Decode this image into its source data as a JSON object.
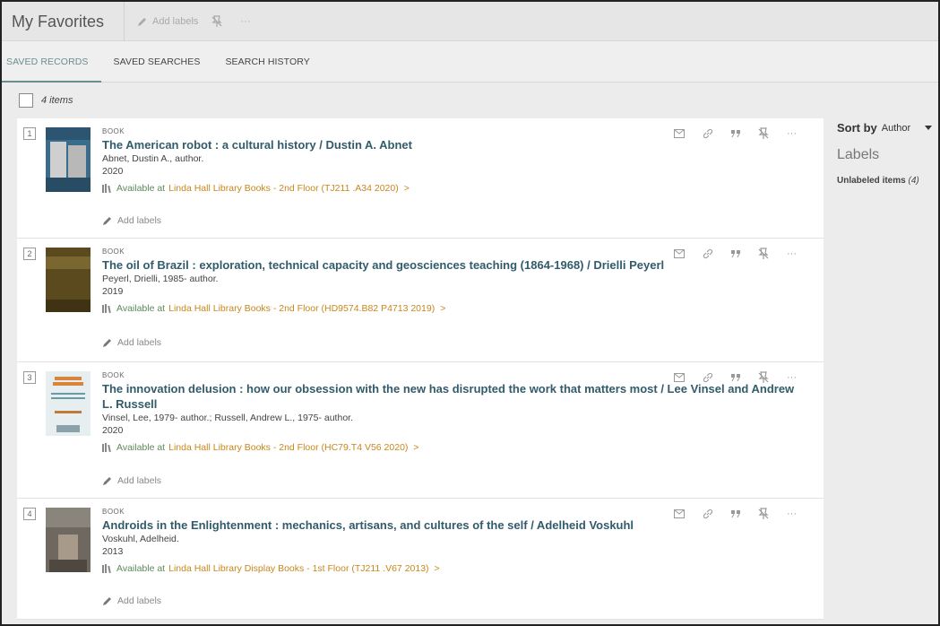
{
  "header": {
    "title": "My Favorites",
    "add_labels": "Add labels",
    "more": "···"
  },
  "tabs": [
    {
      "label": "SAVED RECORDS",
      "active": true
    },
    {
      "label": "SAVED SEARCHES",
      "active": false
    },
    {
      "label": "SEARCH HISTORY",
      "active": false
    }
  ],
  "count_text": "4 items",
  "items": [
    {
      "num": "1",
      "type": "BOOK",
      "title": "The American robot : a cultural history / Dustin A. Abnet",
      "author": "Abnet, Dustin A., author.",
      "year": "2020",
      "avail_prefix": "Available at",
      "location": "Linda Hall Library  Books - 2nd Floor (TJ211 .A34 2020)",
      "chevron": ">",
      "add_labels": "Add labels",
      "cover_color": "#3a6d8c"
    },
    {
      "num": "2",
      "type": "BOOK",
      "title": "The oil of Brazil : exploration, technical capacity and geosciences teaching (1864-1968) / Drielli Peyerl",
      "author": "Peyerl, Drielli, 1985- author.",
      "year": "2019",
      "avail_prefix": "Available at",
      "location": "Linda Hall Library  Books - 2nd Floor (HD9574.B82 P4713 2019)",
      "chevron": ">",
      "add_labels": "Add labels",
      "cover_color": "#5b4a1e"
    },
    {
      "num": "3",
      "type": "BOOK",
      "title": "The innovation delusion : how our obsession with the new has disrupted the work that matters most / Lee Vinsel and Andrew L. Russell",
      "author": "Vinsel, Lee, 1979- author.; Russell, Andrew L., 1975- author.",
      "year": "2020",
      "avail_prefix": "Available at",
      "location": "Linda Hall Library  Books - 2nd Floor (HC79.T4 V56 2020)",
      "chevron": ">",
      "add_labels": "Add labels",
      "cover_color": "#e6eef0"
    },
    {
      "num": "4",
      "type": "BOOK",
      "title": "Androids in the Enlightenment : mechanics, artisans, and cultures of the self / Adelheid Voskuhl",
      "author": "Voskuhl, Adelheid.",
      "year": "2013",
      "avail_prefix": "Available at",
      "location": "Linda Hall Library  Display Books - 1st Floor (TJ211 .V67 2013)",
      "chevron": ">",
      "add_labels": "Add labels",
      "cover_color": "#6e6860"
    }
  ],
  "sidebar": {
    "sort_label": "Sort by",
    "sort_value": "Author",
    "labels_heading": "Labels",
    "unlabeled": "Unlabeled items",
    "unlabeled_count": "(4)"
  }
}
